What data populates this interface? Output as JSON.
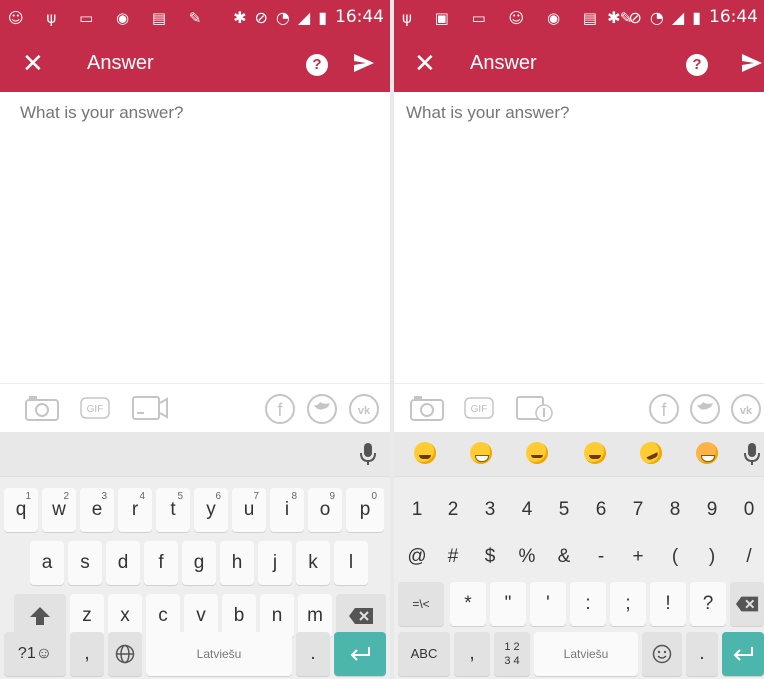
{
  "status": {
    "time": "16:44"
  },
  "appbar": {
    "title": "Answer",
    "help_label": "?"
  },
  "answer": {
    "placeholder": "What is your answer?"
  },
  "attach": {
    "gif_label": "GIF"
  },
  "keyboard_letters": {
    "row1": [
      "q",
      "w",
      "e",
      "r",
      "t",
      "y",
      "u",
      "i",
      "o",
      "p"
    ],
    "row1_hints": [
      "1",
      "2",
      "3",
      "4",
      "5",
      "6",
      "7",
      "8",
      "9",
      "0"
    ],
    "row2": [
      "a",
      "s",
      "d",
      "f",
      "g",
      "h",
      "j",
      "k",
      "l"
    ],
    "row3": [
      "z",
      "x",
      "c",
      "v",
      "b",
      "n",
      "m"
    ],
    "sym_key": "?1☺",
    "comma": ",",
    "space_label": "Latviešu",
    "period": "."
  },
  "keyboard_symbols": {
    "row1": [
      "1",
      "2",
      "3",
      "4",
      "5",
      "6",
      "7",
      "8",
      "9",
      "0"
    ],
    "row2": [
      "@",
      "#",
      "$",
      "%",
      "&",
      "-",
      "+",
      "(",
      ")",
      "/"
    ],
    "row3_first": "=\\<",
    "row3": [
      "*",
      "\"",
      "'",
      ":",
      ";",
      "!",
      "?"
    ],
    "abc_key": "ABC",
    "comma": ",",
    "numpad_key": "1 2\n3 4",
    "space_label": "Latviešu",
    "period": "."
  }
}
